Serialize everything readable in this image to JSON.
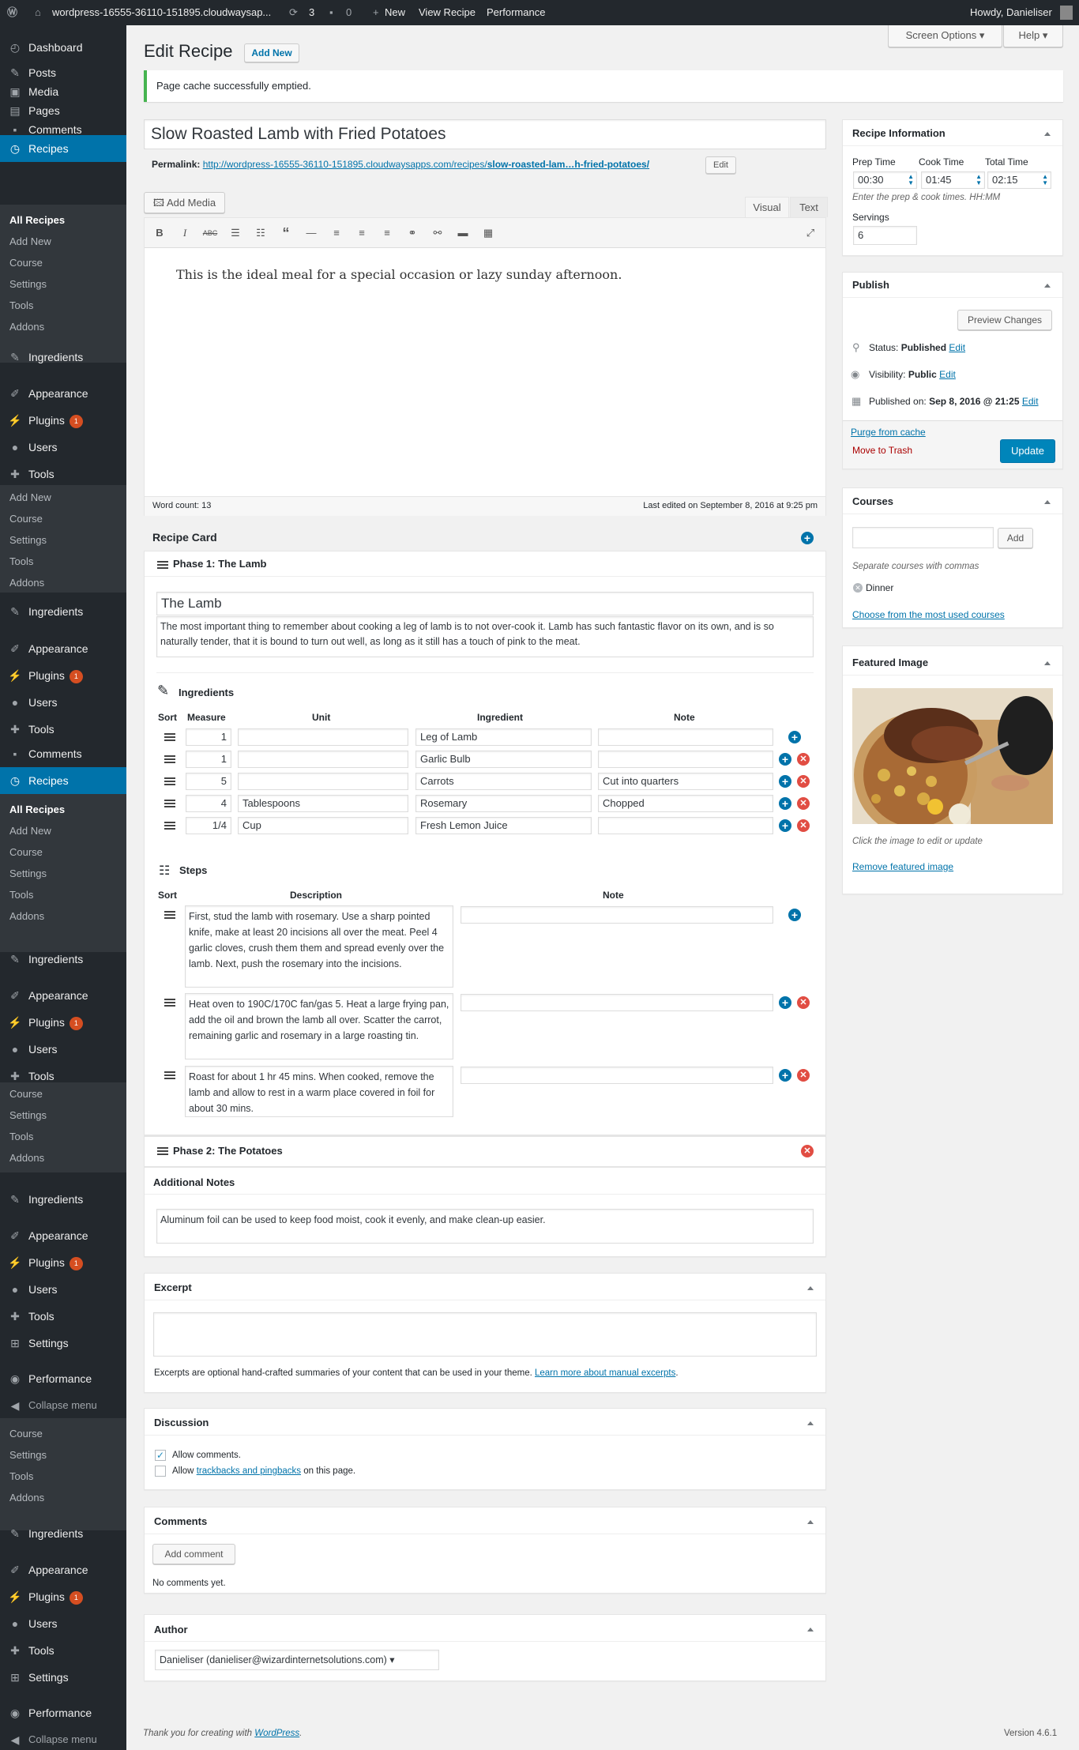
{
  "admin_bar": {
    "site": "wordpress-16555-36110-151895.cloudwaysap...",
    "updates": "3",
    "comments": "0",
    "new": "New",
    "view": "View Recipe",
    "performance": "Performance",
    "howdy": "Howdy, Danieliser"
  },
  "sidebar": {
    "top": [
      {
        "label": "Dashboard"
      },
      {
        "label": "Posts"
      },
      {
        "label": "Media"
      },
      {
        "label": "Pages"
      },
      {
        "label": "Comments"
      },
      {
        "label": "Recipes"
      }
    ],
    "recipes_sub": [
      "All Recipes",
      "Add New",
      "Course",
      "Settings",
      "Tools",
      "Addons"
    ],
    "ingredients": "Ingredients",
    "appearance": "Appearance",
    "plugins": "Plugins",
    "plugins_badge": "1",
    "users": "Users",
    "tools": "Tools",
    "tools_sub": [
      "Add New",
      "Course",
      "Settings",
      "Tools",
      "Addons"
    ],
    "comments": "Comments",
    "recipes": "Recipes",
    "settings": "Settings",
    "performance": "Performance",
    "collapse": "Collapse menu"
  },
  "header": {
    "screen_options": "Screen Options",
    "help": "Help",
    "title": "Edit Recipe",
    "add_new": "Add New",
    "notice": "Page cache successfully emptied."
  },
  "post": {
    "title": "Slow Roasted Lamb with Fried Potatoes",
    "permalink_label": "Permalink:",
    "permalink_base": "http://wordpress-16555-36110-151895.cloudwaysapps.com/recipes/",
    "permalink_slug": "slow-roasted-lam…h-fried-potatoes/",
    "edit": "Edit",
    "add_media": "Add Media",
    "tab_visual": "Visual",
    "tab_text": "Text",
    "content": "This is the ideal meal for a special occasion or lazy sunday afternoon.",
    "word_count": "Word count: 13",
    "last_edited": "Last edited on September 8, 2016 at 9:25 pm"
  },
  "recipe_card": {
    "title": "Recipe Card",
    "phase1": "Phase 1: The Lamb",
    "phase_name": "The Lamb",
    "phase_desc": "The most important thing to remember about cooking a leg of lamb is to not over-cook it. Lamb has such fantastic flavor on its own, and is so naturally tender, that it is bound to turn out well, as long as it still has a touch of pink to the meat.",
    "ingredients_title": "Ingredients",
    "ing_headers": [
      "Sort",
      "Measure",
      "Unit",
      "Ingredient",
      "Note"
    ],
    "ingredients": [
      {
        "measure": "1",
        "unit": "",
        "ingredient": "Leg of Lamb",
        "note": ""
      },
      {
        "measure": "1",
        "unit": "",
        "ingredient": "Garlic Bulb",
        "note": ""
      },
      {
        "measure": "5",
        "unit": "",
        "ingredient": "Carrots",
        "note": "Cut into quarters"
      },
      {
        "measure": "4",
        "unit": "Tablespoons",
        "ingredient": "Rosemary",
        "note": "Chopped"
      },
      {
        "measure": "1/4",
        "unit": "Cup",
        "ingredient": "Fresh Lemon Juice",
        "note": ""
      }
    ],
    "steps_title": "Steps",
    "step_headers": [
      "Sort",
      "Description",
      "Note"
    ],
    "steps": [
      {
        "desc": "First, stud the lamb with rosemary. Use a sharp pointed knife, make at least 20 incisions all over the meat. Peel 4 garlic cloves, crush them them and spread evenly over the lamb. Next, push the rosemary into the incisions.",
        "note": ""
      },
      {
        "desc": "Heat oven to 190C/170C fan/gas 5. Heat a large frying pan, add the oil and brown the lamb all over. Scatter the carrot, remaining garlic and rosemary in a large roasting tin.",
        "note": ""
      },
      {
        "desc": "Roast for about 1 hr 45 mins. When cooked, remove the lamb and allow to rest in a warm place covered in foil for about 30 mins.",
        "note": ""
      }
    ],
    "phase2": "Phase 2: The Potatoes",
    "notes_title": "Additional Notes",
    "notes": "Aluminum foil can be used to keep food moist, cook it evenly, and make clean-up easier."
  },
  "excerpt": {
    "title": "Excerpt",
    "help": "Excerpts are optional hand-crafted summaries of your content that can be used in your theme.",
    "link": "Learn more about manual excerpts"
  },
  "discussion": {
    "title": "Discussion",
    "allow_comments": "Allow comments.",
    "allow_pre": "Allow",
    "allow_link": "trackbacks and pingbacks",
    "allow_post": "on this page."
  },
  "comments_box": {
    "title": "Comments",
    "add": "Add comment",
    "none": "No comments yet."
  },
  "author": {
    "title": "Author",
    "value": "Danieliser (danieliser@wizardinternetsolutions.com)"
  },
  "recipe_info": {
    "title": "Recipe Information",
    "prep_label": "Prep Time",
    "cook_label": "Cook Time",
    "total_label": "Total Time",
    "prep": "00:30",
    "cook": "01:45",
    "total": "02:15",
    "hint": "Enter the prep & cook times. HH:MM",
    "servings_label": "Servings",
    "servings": "6"
  },
  "publish": {
    "title": "Publish",
    "preview": "Preview Changes",
    "status_label": "Status:",
    "status": "Published",
    "visibility_label": "Visibility:",
    "visibility": "Public",
    "published_label": "Published on:",
    "published": "Sep 8, 2016 @ 21:25",
    "edit": "Edit",
    "purge": "Purge from cache",
    "trash": "Move to Trash",
    "update": "Update"
  },
  "courses": {
    "title": "Courses",
    "add": "Add",
    "hint": "Separate courses with commas",
    "tag": "Dinner",
    "choose": "Choose from the most used courses"
  },
  "featured": {
    "title": "Featured Image",
    "hint": "Click the image to edit or update",
    "remove": "Remove featured image"
  },
  "footer": {
    "thanks_pre": "Thank you for creating with",
    "thanks_link": "WordPress",
    "thanks_post": ".",
    "version": "Version 4.6.1"
  }
}
